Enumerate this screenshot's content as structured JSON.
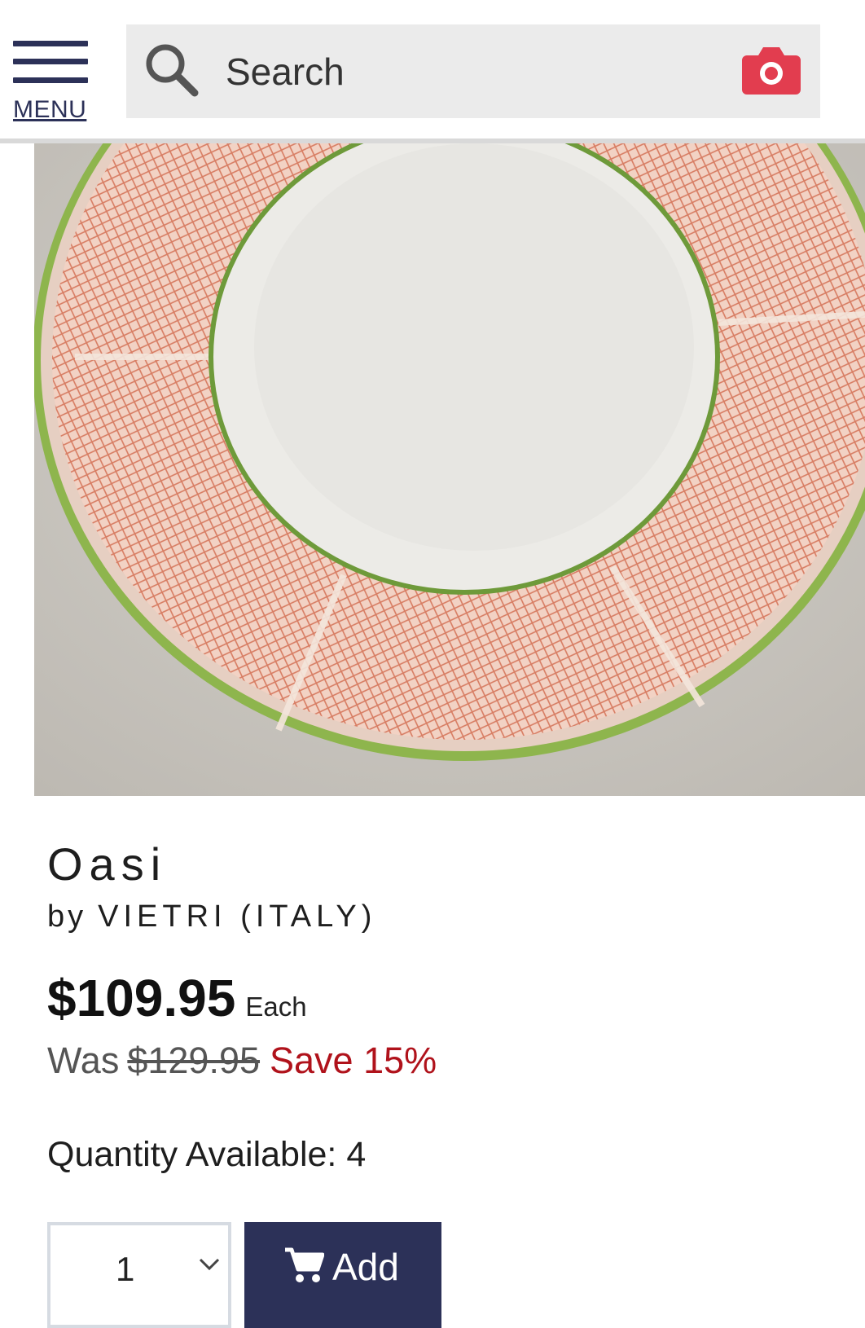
{
  "header": {
    "menu_label": "MENU",
    "search_placeholder": "Search"
  },
  "product": {
    "title": "Oasi",
    "brand_prefix": "by",
    "brand": "VIETRI (ITALY)",
    "price": "$109.95",
    "price_unit": "Each",
    "was_label": "Was",
    "was_price": "$129.95",
    "save_text": "Save 15%",
    "quantity_available": "Quantity Available: 4",
    "quantity_selected": "1",
    "add_label": "Add",
    "image_alt": "scalloped dinner plate with coral lattice rim and green edge"
  },
  "colors": {
    "navy": "#2c3158",
    "sale_red": "#b0121b",
    "camera_red": "#e23d4f",
    "search_bg": "#ebebeb"
  },
  "icons": [
    "menu-icon",
    "search-icon",
    "camera-icon",
    "chevron-down-icon",
    "cart-icon"
  ]
}
